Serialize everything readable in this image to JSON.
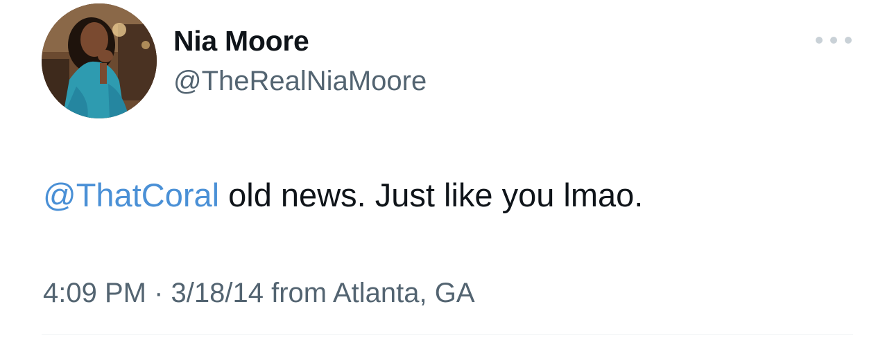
{
  "author": {
    "display_name": "Nia Moore",
    "handle": "@TheRealNiaMoore"
  },
  "menu": {
    "more_icon": "more-horizontal-icon"
  },
  "tweet": {
    "mention": "@ThatCoral",
    "body": " old news. Just like you lmao."
  },
  "meta": {
    "time": "4:09 PM",
    "separator": " · ",
    "date": "3/18/14",
    "source": " from Atlanta, GA"
  },
  "colors": {
    "text_primary": "#0f1419",
    "text_secondary": "#536471",
    "mention": "#4a90d6",
    "more_dots": "#c9d1d7"
  }
}
